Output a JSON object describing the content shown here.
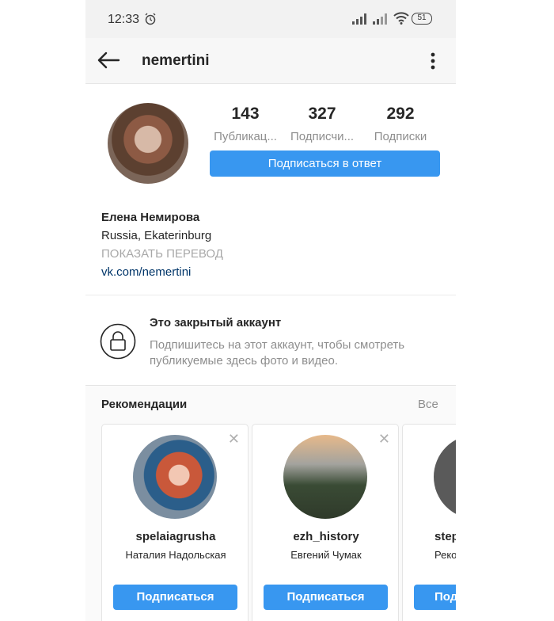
{
  "status_bar": {
    "time": "12:33",
    "battery": "51"
  },
  "header": {
    "username": "nemertini"
  },
  "profile": {
    "stats": [
      {
        "value": "143",
        "label": "Публикац..."
      },
      {
        "value": "327",
        "label": "Подписчи..."
      },
      {
        "value": "292",
        "label": "Подписки"
      }
    ],
    "follow_back_label": "Подписаться в ответ",
    "name": "Елена Немирова",
    "location": "Russia, Ekaterinburg",
    "translate_label": "ПОКАЗАТЬ ПЕРЕВОД",
    "link": "vk.com/nemertini"
  },
  "private_account": {
    "title": "Это закрытый аккаунт",
    "description": "Подпишитесь на этот аккаунт, чтобы смотреть публикуемые здесь фото и видео."
  },
  "recommendations": {
    "title": "Рекомендации",
    "all_label": "Все",
    "cards": [
      {
        "username": "spelaiagrusha",
        "name": "Наталия Надольская",
        "button": "Подписаться"
      },
      {
        "username": "ezh_history",
        "name": "Евгений Чумак",
        "button": "Подписаться"
      },
      {
        "username": "step",
        "name": "Реко",
        "button": "Под"
      }
    ]
  },
  "colors": {
    "accent": "#3897f0",
    "link": "#003569",
    "secondary_text": "#8e8e8e"
  }
}
